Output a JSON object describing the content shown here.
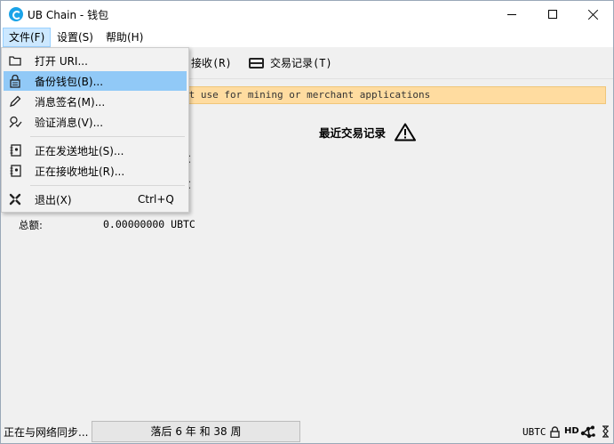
{
  "window": {
    "title": "UB Chain - 钱包"
  },
  "menubar": {
    "file": "文件(F)",
    "settings": "设置(S)",
    "help": "帮助(H)"
  },
  "file_menu": {
    "items": [
      {
        "label": "打开 URI...",
        "icon": "folder-icon"
      },
      {
        "label": "备份钱包(B)...",
        "icon": "backup-icon",
        "highlighted": true
      },
      {
        "label": "消息签名(M)...",
        "icon": "pen-icon"
      },
      {
        "label": "验证消息(V)...",
        "icon": "verify-icon"
      },
      {
        "label": "正在发送地址(S)...",
        "icon": "address-book-icon"
      },
      {
        "label": "正在接收地址(R)...",
        "icon": "address-book-icon"
      },
      {
        "label": "退出(X)",
        "icon": "quit-icon",
        "shortcut": "Ctrl+Q"
      }
    ]
  },
  "toolbar": {
    "receive": "接收(R)",
    "transactions": "交易记录(T)"
  },
  "warning": {
    "text": "r use at your own risk - do not use for mining or merchant applications"
  },
  "overview": {
    "recent_title": "最近交易记录",
    "balance_suffix_1": "TC",
    "balance_suffix_2": "TC",
    "total_label": "总额:",
    "total_value": "0.00000000 UBTC"
  },
  "statusbar": {
    "sync_text": "正在与网络同步...",
    "progress_text": "落后 6 年 和 38 周",
    "unit": "UBTC",
    "hd": "HD"
  },
  "colors": {
    "highlight": "#91c9f7",
    "warning_bg": "#ffdca0",
    "menu_active": "#cce8ff"
  }
}
